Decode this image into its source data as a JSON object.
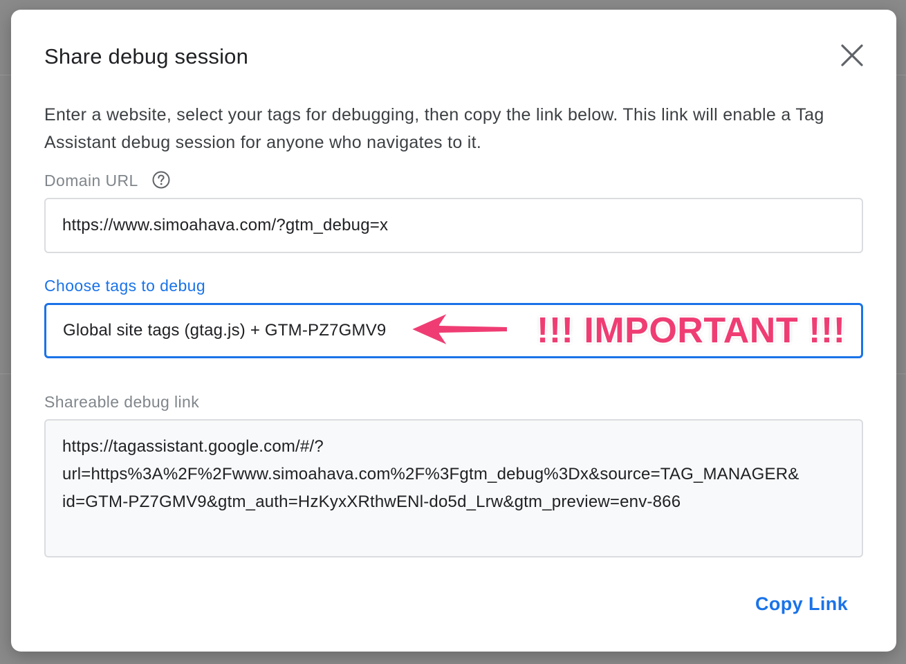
{
  "dialog": {
    "title": "Share debug session",
    "description": "Enter a website, select your tags for debugging, then copy the link below. This link will enable a Tag Assistant debug session for anyone who navigates to it.",
    "close_icon": "close-icon"
  },
  "domain": {
    "label": "Domain URL",
    "help_icon": "help-circle-icon",
    "value": "https://www.simoahava.com/?gtm_debug=x"
  },
  "tags": {
    "label": "Choose tags to debug",
    "value": "Global site tags (gtag.js) + GTM-PZ7GMV9"
  },
  "annotation": {
    "text": "!!! IMPORTANT !!!",
    "arrow_icon": "left-arrow-icon",
    "color": "#ef3d73"
  },
  "link": {
    "label": "Shareable debug link",
    "lines": [
      "https://tagassistant.google.com/#/?",
      "url=https%3A%2F%2Fwww.simoahava.com%2F%3Fgtm_debug%3Dx&source=TAG_MANAGER&",
      "id=GTM-PZ7GMV9&gtm_auth=HzKyxXRthwENl-do5d_Lrw&gtm_preview=env-866"
    ]
  },
  "actions": {
    "copy_label": "Copy Link"
  },
  "colors": {
    "accent": "#1a73e8",
    "annotation": "#ef3d73"
  }
}
